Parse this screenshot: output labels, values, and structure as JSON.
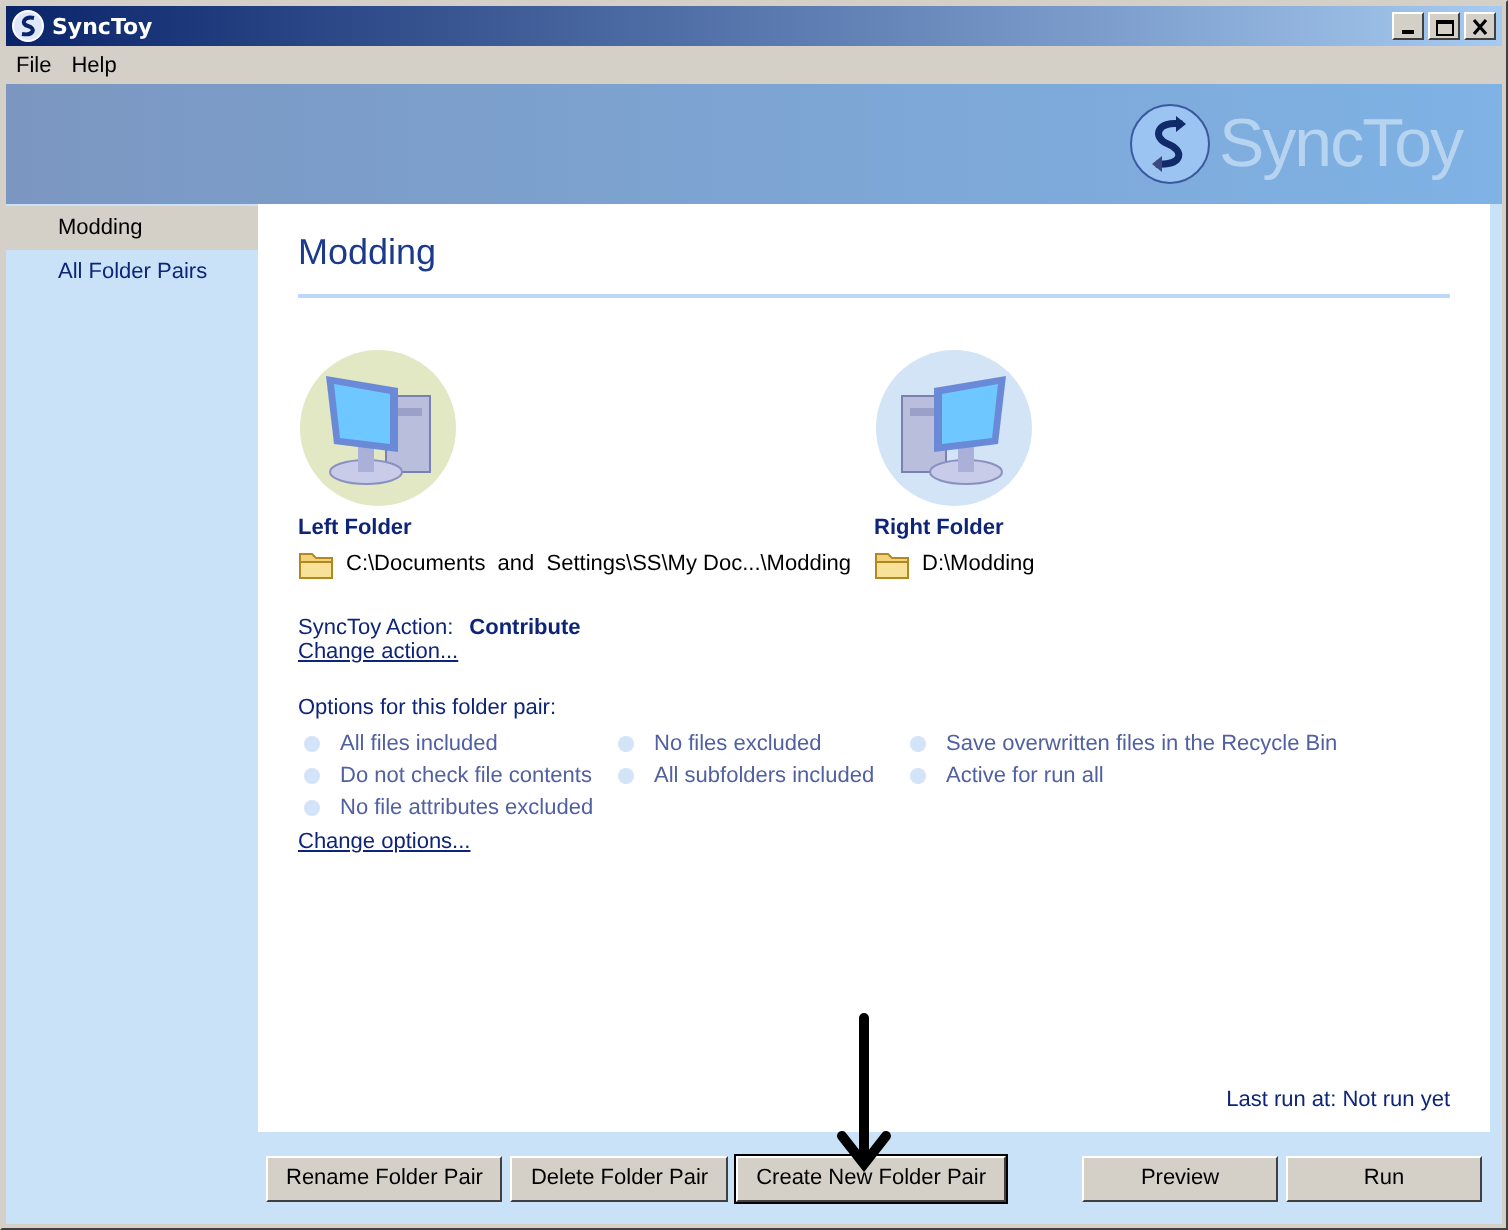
{
  "window": {
    "title": "SyncToy"
  },
  "menu": [
    "File",
    "Help"
  ],
  "banner": {
    "logo_text": "SyncToy"
  },
  "sidebar": {
    "items": [
      {
        "label": "Modding",
        "selected": true
      },
      {
        "label": "All Folder Pairs",
        "selected": false
      }
    ]
  },
  "pair": {
    "title": "Modding",
    "folders": [
      {
        "label": "Left Folder",
        "path": "C:\\Documents  and  Settings\\SS\\My Doc...\\Modding",
        "color": "#e3e8c4"
      },
      {
        "label": "Right Folder",
        "path": "D:\\Modding",
        "color": "#d3e4f6"
      }
    ],
    "action_label": "SyncToy Action:",
    "action": "Contribute",
    "change_action": "Change action...",
    "options_heading": "Options for this folder pair:",
    "options": [
      "All files included",
      "No files excluded",
      "Save overwritten files in the Recycle Bin",
      "Do not check file contents",
      "All subfolders included",
      "Active for run all",
      "No file attributes excluded"
    ],
    "change_options": "Change options...",
    "last_run": "Last run at: Not run yet"
  },
  "buttons_left": [
    {
      "label": "Rename Folder Pair",
      "focused": false
    },
    {
      "label": "Delete Folder Pair",
      "focused": false
    },
    {
      "label": "Create New Folder Pair",
      "focused": true
    }
  ],
  "buttons_right": [
    {
      "label": "Preview",
      "focused": false
    },
    {
      "label": "Run",
      "focused": false
    }
  ]
}
